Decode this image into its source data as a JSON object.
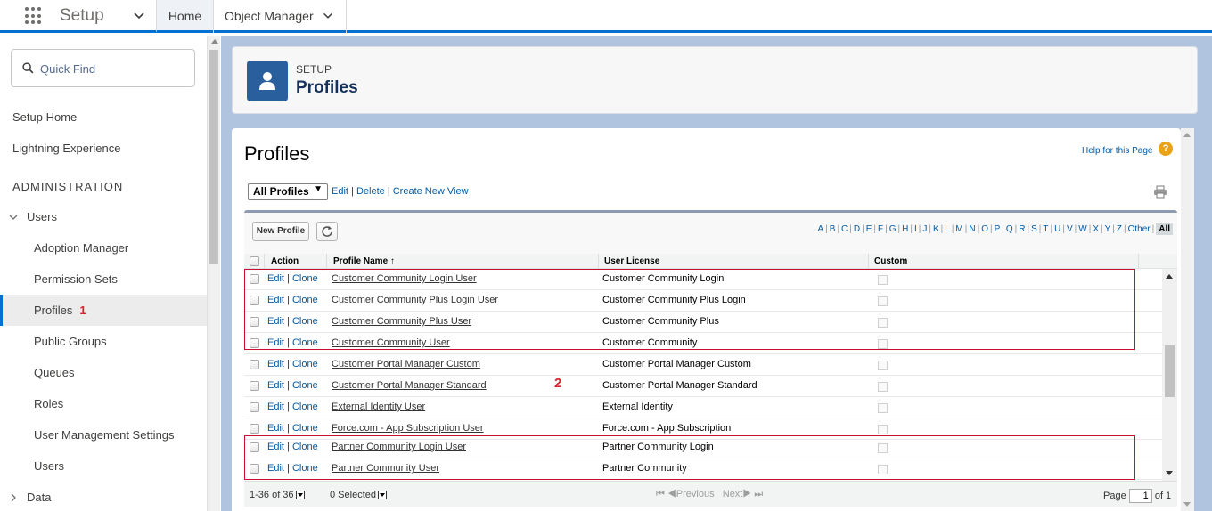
{
  "topbar": {
    "app_name": "Setup",
    "tabs": [
      {
        "label": "Home",
        "active": true
      },
      {
        "label": "Object Manager",
        "active": false
      }
    ]
  },
  "sidebar": {
    "search_placeholder": "Quick Find",
    "top_items": [
      "Setup Home",
      "Lightning Experience"
    ],
    "section_heading": "ADMINISTRATION",
    "group_users": "Users",
    "user_items": [
      "Adoption Manager",
      "Permission Sets",
      "Profiles",
      "Public Groups",
      "Queues",
      "Roles",
      "User Management Settings",
      "Users"
    ],
    "selected_item": "Profiles",
    "annotation_1": "1",
    "group_data": "Data"
  },
  "header": {
    "eyebrow": "SETUP",
    "title": "Profiles"
  },
  "content": {
    "page_title": "Profiles",
    "help_link": "Help for this Page",
    "help_icon_glyph": "?",
    "view_selected": "All Profiles",
    "view_links": [
      "Edit",
      "Delete",
      "Create New View"
    ],
    "new_button": "New Profile",
    "alphabet": [
      "A",
      "B",
      "C",
      "D",
      "E",
      "F",
      "G",
      "H",
      "I",
      "J",
      "K",
      "L",
      "M",
      "N",
      "O",
      "P",
      "Q",
      "R",
      "S",
      "T",
      "U",
      "V",
      "W",
      "X",
      "Y",
      "Z",
      "Other",
      "All"
    ],
    "columns": {
      "action": "Action",
      "profile_name": "Profile Name",
      "sort_indicator": "↑",
      "user_license": "User License",
      "custom": "Custom"
    },
    "row_actions": {
      "edit": "Edit",
      "clone": "Clone"
    },
    "rows": [
      {
        "name": "Customer Community Login User",
        "license": "Customer Community Login"
      },
      {
        "name": "Customer Community Plus Login User",
        "license": "Customer Community Plus Login"
      },
      {
        "name": "Customer Community Plus User",
        "license": "Customer Community Plus"
      },
      {
        "name": "Customer Community User",
        "license": "Customer Community"
      },
      {
        "name": "Customer Portal Manager Custom",
        "license": "Customer Portal Manager Custom"
      },
      {
        "name": "Customer Portal Manager Standard",
        "license": "Customer Portal Manager Standard"
      },
      {
        "name": "External Identity User",
        "license": "External Identity"
      },
      {
        "name": "Force.com - App Subscription User",
        "license": "Force.com - App Subscription"
      },
      {
        "name": "Partner Community Login User",
        "license": "Partner Community Login"
      },
      {
        "name": "Partner Community User",
        "license": "Partner Community"
      }
    ],
    "annotation_2": "2",
    "footer": {
      "range": "1-36 of 36",
      "selected": "0 Selected",
      "previous": "Previous",
      "next": "Next",
      "page_label": "Page",
      "page_value": "1",
      "of_total": "of 1"
    }
  },
  "colors": {
    "brand_blue": "#0070d2",
    "link_blue": "#015ba7",
    "highlight_red": "#c8102e",
    "header_icon": "#2a5f9e"
  }
}
